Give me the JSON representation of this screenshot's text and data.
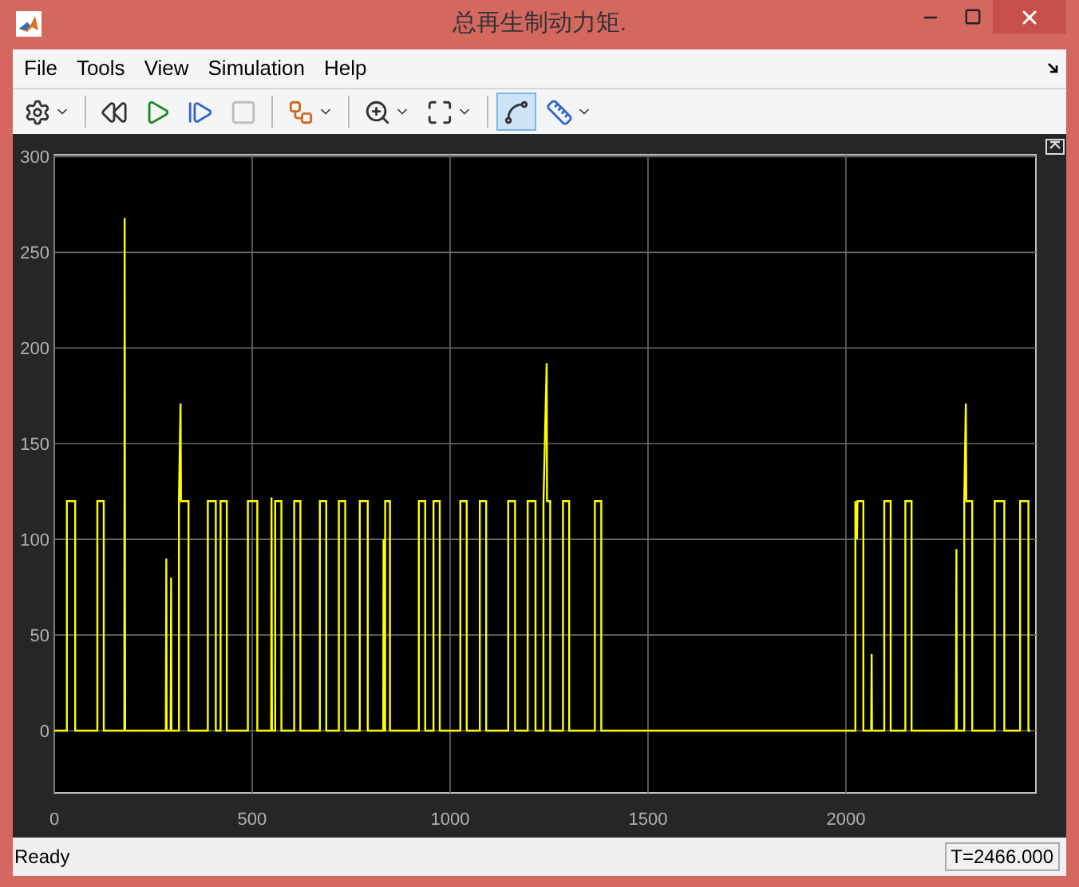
{
  "window": {
    "title": "总再生制动力矩."
  },
  "menu": [
    {
      "label": "File"
    },
    {
      "label": "Tools"
    },
    {
      "label": "View"
    },
    {
      "label": "Simulation"
    },
    {
      "label": "Help"
    }
  ],
  "toolbar": [
    {
      "kind": "settings",
      "dropdown": true,
      "pressed": false,
      "disabled": false
    },
    {
      "kind": "separator"
    },
    {
      "kind": "step-back",
      "dropdown": false,
      "pressed": false,
      "disabled": false
    },
    {
      "kind": "run",
      "dropdown": false,
      "pressed": false,
      "disabled": false
    },
    {
      "kind": "step-forward",
      "dropdown": false,
      "pressed": false,
      "disabled": false
    },
    {
      "kind": "stop",
      "dropdown": false,
      "pressed": false,
      "disabled": true
    },
    {
      "kind": "separator"
    },
    {
      "kind": "highlight",
      "dropdown": true,
      "pressed": false,
      "disabled": false
    },
    {
      "kind": "separator"
    },
    {
      "kind": "zoom",
      "dropdown": true,
      "pressed": false,
      "disabled": false
    },
    {
      "kind": "fit",
      "dropdown": true,
      "pressed": false,
      "disabled": false
    },
    {
      "kind": "separator"
    },
    {
      "kind": "trigger",
      "dropdown": false,
      "pressed": true,
      "disabled": false
    },
    {
      "kind": "measure",
      "dropdown": true,
      "pressed": false,
      "disabled": false
    }
  ],
  "scope": {
    "chart_data": {
      "type": "line",
      "grid": true,
      "xlim": [
        0,
        2480
      ],
      "ylim": [
        -32.5,
        301
      ],
      "xticks": [
        0,
        500,
        1000,
        1500,
        2000
      ],
      "yticks": [
        0,
        50,
        100,
        150,
        200,
        250,
        300
      ],
      "x": [
        0,
        32,
        32,
        53,
        53,
        109,
        109,
        125,
        125,
        177,
        178,
        179,
        282,
        283,
        284,
        294,
        295,
        296,
        315,
        315,
        319,
        320,
        339,
        339,
        388,
        388,
        408,
        408,
        420,
        420,
        436,
        436,
        489,
        489,
        513,
        513,
        548,
        549,
        550,
        558,
        558,
        574,
        574,
        606,
        606,
        622,
        622,
        671,
        671,
        687,
        687,
        719,
        719,
        735,
        735,
        772,
        772,
        792,
        792,
        831,
        832,
        833,
        836,
        836,
        848,
        848,
        921,
        921,
        937,
        937,
        958,
        958,
        974,
        974,
        1026,
        1026,
        1042,
        1042,
        1075,
        1075,
        1091,
        1091,
        1147,
        1147,
        1164,
        1164,
        1196,
        1196,
        1216,
        1216,
        1236,
        1236,
        1244,
        1245,
        1253,
        1253,
        1285,
        1285,
        1301,
        1301,
        1366,
        1366,
        1382,
        1382,
        2024,
        2024,
        2028,
        2029,
        2044,
        2044,
        2064,
        2065,
        2066,
        2097,
        2097,
        2113,
        2113,
        2150,
        2150,
        2166,
        2166,
        2278,
        2279,
        2280,
        2299,
        2299,
        2303,
        2304,
        2319,
        2319,
        2376,
        2376,
        2400,
        2400,
        2440,
        2440,
        2461,
        2461,
        2466
      ],
      "series": [
        {
          "color": "#ffff00",
          "values": [
            0,
            0,
            120,
            120,
            0,
            0,
            120,
            120,
            0,
            0,
            268,
            0,
            0,
            90,
            0,
            0,
            80,
            0,
            0,
            120,
            171,
            120,
            120,
            0,
            0,
            120,
            120,
            0,
            0,
            120,
            120,
            0,
            0,
            120,
            120,
            0,
            0,
            122,
            0,
            0,
            120,
            120,
            0,
            0,
            120,
            120,
            0,
            0,
            120,
            120,
            0,
            0,
            120,
            120,
            0,
            0,
            120,
            120,
            0,
            0,
            100,
            0,
            0,
            120,
            120,
            0,
            0,
            120,
            120,
            0,
            0,
            120,
            120,
            0,
            0,
            120,
            120,
            0,
            0,
            120,
            120,
            0,
            0,
            120,
            120,
            0,
            0,
            120,
            120,
            0,
            0,
            120,
            192,
            120,
            120,
            0,
            0,
            120,
            120,
            0,
            0,
            120,
            120,
            0,
            0,
            120,
            100,
            120,
            120,
            0,
            0,
            40,
            0,
            0,
            120,
            120,
            0,
            0,
            120,
            120,
            0,
            0,
            95,
            0,
            0,
            120,
            171,
            120,
            120,
            0,
            0,
            120,
            120,
            0,
            0,
            120,
            120,
            0,
            0
          ]
        }
      ]
    }
  },
  "status_bar": {
    "message": "Ready",
    "time": "T=2466.000"
  }
}
